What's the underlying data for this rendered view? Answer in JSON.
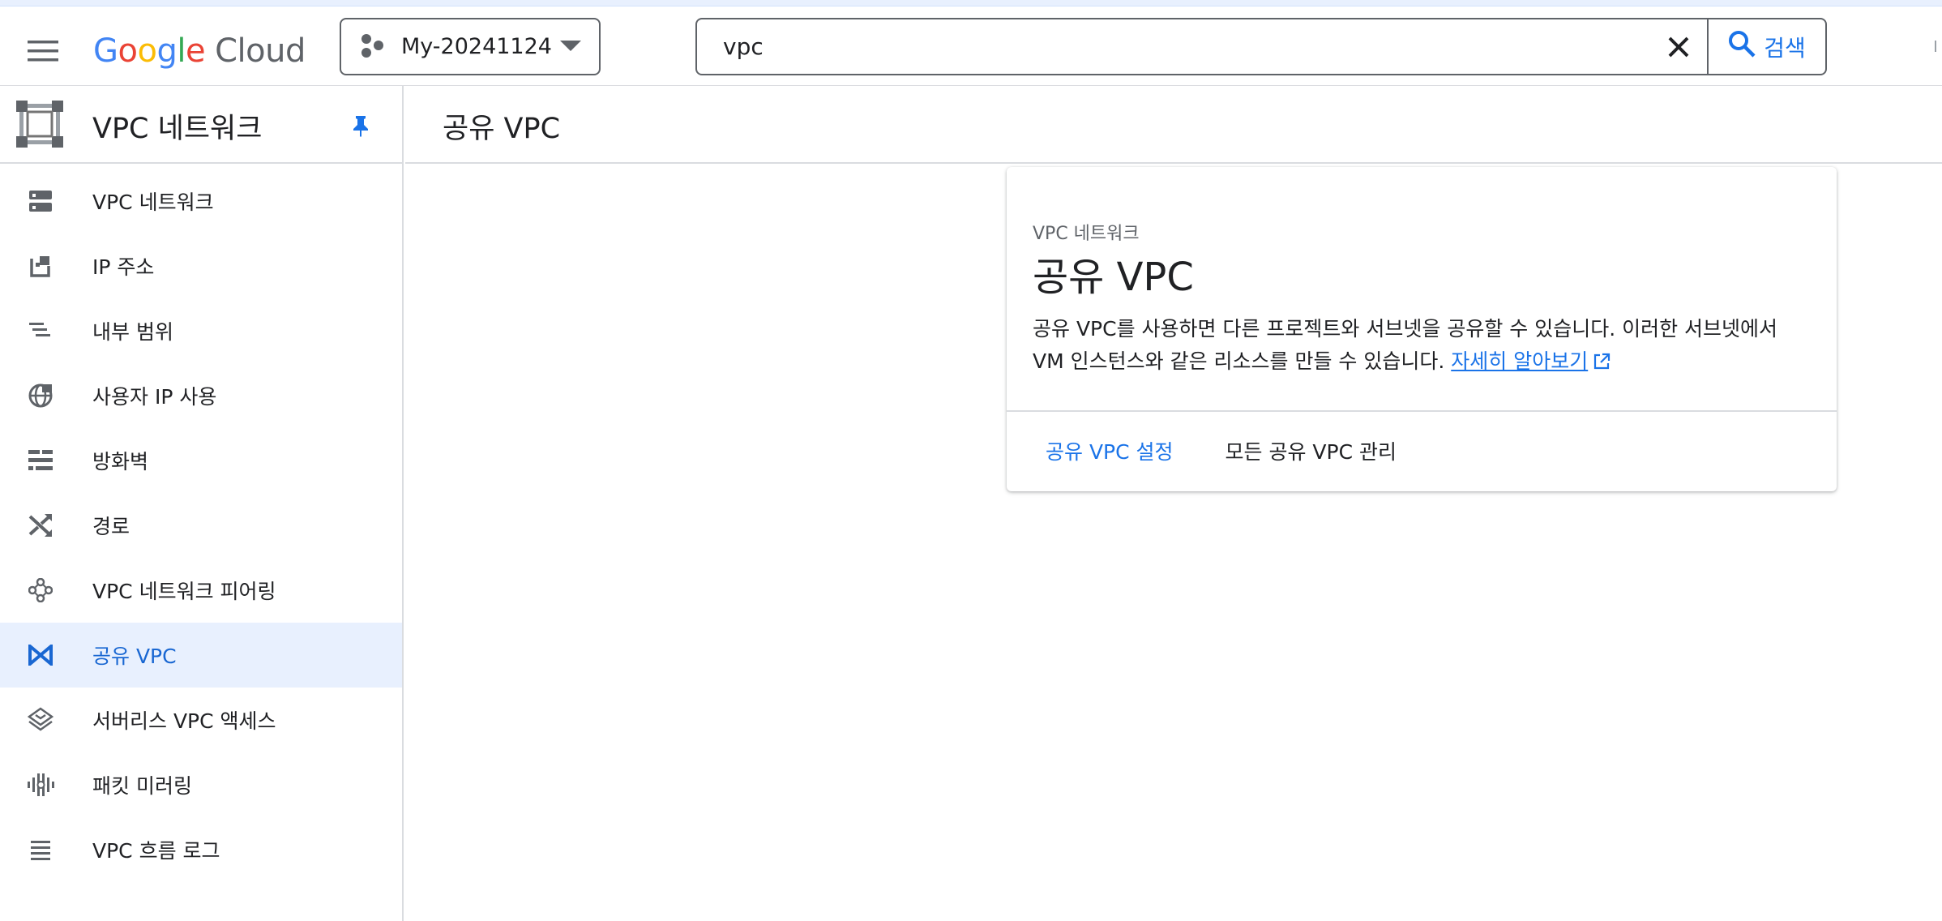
{
  "topbar": {
    "logo_google": "Google",
    "logo_cloud": "Cloud",
    "project_name": "My-20241124",
    "search_value": "vpc",
    "search_button_label": "검색"
  },
  "sidebar": {
    "product_title": "VPC 네트워크",
    "items": [
      {
        "label": "VPC 네트워크",
        "icon": "vpc-networks-icon"
      },
      {
        "label": "IP 주소",
        "icon": "ip-address-icon"
      },
      {
        "label": "내부 범위",
        "icon": "internal-ranges-icon"
      },
      {
        "label": "사용자 IP 사용",
        "icon": "byoip-globe-icon"
      },
      {
        "label": "방화벽",
        "icon": "firewall-icon"
      },
      {
        "label": "경로",
        "icon": "routes-icon"
      },
      {
        "label": "VPC 네트워크 피어링",
        "icon": "peering-icon"
      },
      {
        "label": "공유 VPC",
        "icon": "shared-vpc-icon",
        "active": true
      },
      {
        "label": "서버리스 VPC 액세스",
        "icon": "serverless-icon"
      },
      {
        "label": "패킷 미러링",
        "icon": "packet-mirroring-icon"
      },
      {
        "label": "VPC 흐름 로그",
        "icon": "flow-logs-icon"
      }
    ]
  },
  "main": {
    "page_title": "공유 VPC",
    "card": {
      "eyebrow": "VPC 네트워크",
      "title": "공유 VPC",
      "description": "공유 VPC를 사용하면 다른 프로젝트와 서브넷을 공유할 수 있습니다. 이러한 서브넷에서 VM 인스턴스와 같은 리소스를 만들 수 있습니다. ",
      "learn_more": "자세히 알아보기",
      "action_primary": "공유 VPC 설정",
      "action_secondary": "모든 공유 VPC 관리"
    }
  },
  "colors": {
    "accent": "#1a73e8",
    "active_bg": "#e8f0fe",
    "google_blue": "#4285F4",
    "google_red": "#EA4335",
    "google_yellow": "#FBBC05",
    "google_green": "#34A853"
  }
}
